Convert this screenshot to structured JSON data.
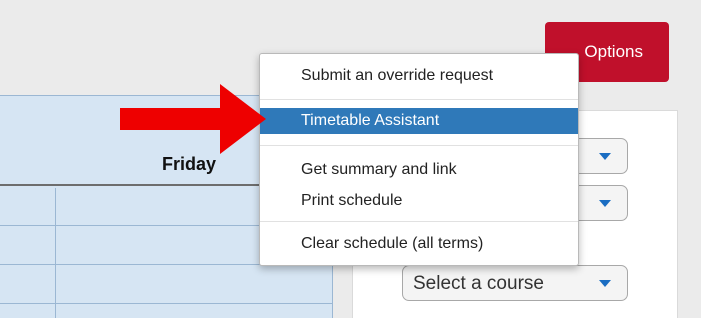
{
  "header": {
    "options_label": "Options"
  },
  "calendar": {
    "day_label": "Friday"
  },
  "panel": {
    "course_select_value": "Select a course"
  },
  "menu": {
    "items": [
      {
        "label": "Submit an override request",
        "selected": false
      },
      {
        "label": "Timetable Assistant",
        "selected": true
      },
      {
        "label": "Get summary and link",
        "selected": false
      },
      {
        "label": "Print schedule",
        "selected": false
      },
      {
        "label": "Clear schedule (all terms)",
        "selected": false
      }
    ]
  },
  "colors": {
    "options_button": "#c0102b",
    "menu_highlight": "#2f79b9",
    "calendar_bg": "#d6e5f3",
    "arrow": "#ee0000",
    "caret": "#1a6dc2"
  },
  "icons": {
    "select_caret": "caret-down-icon",
    "annotation": "red-arrow-icon"
  }
}
